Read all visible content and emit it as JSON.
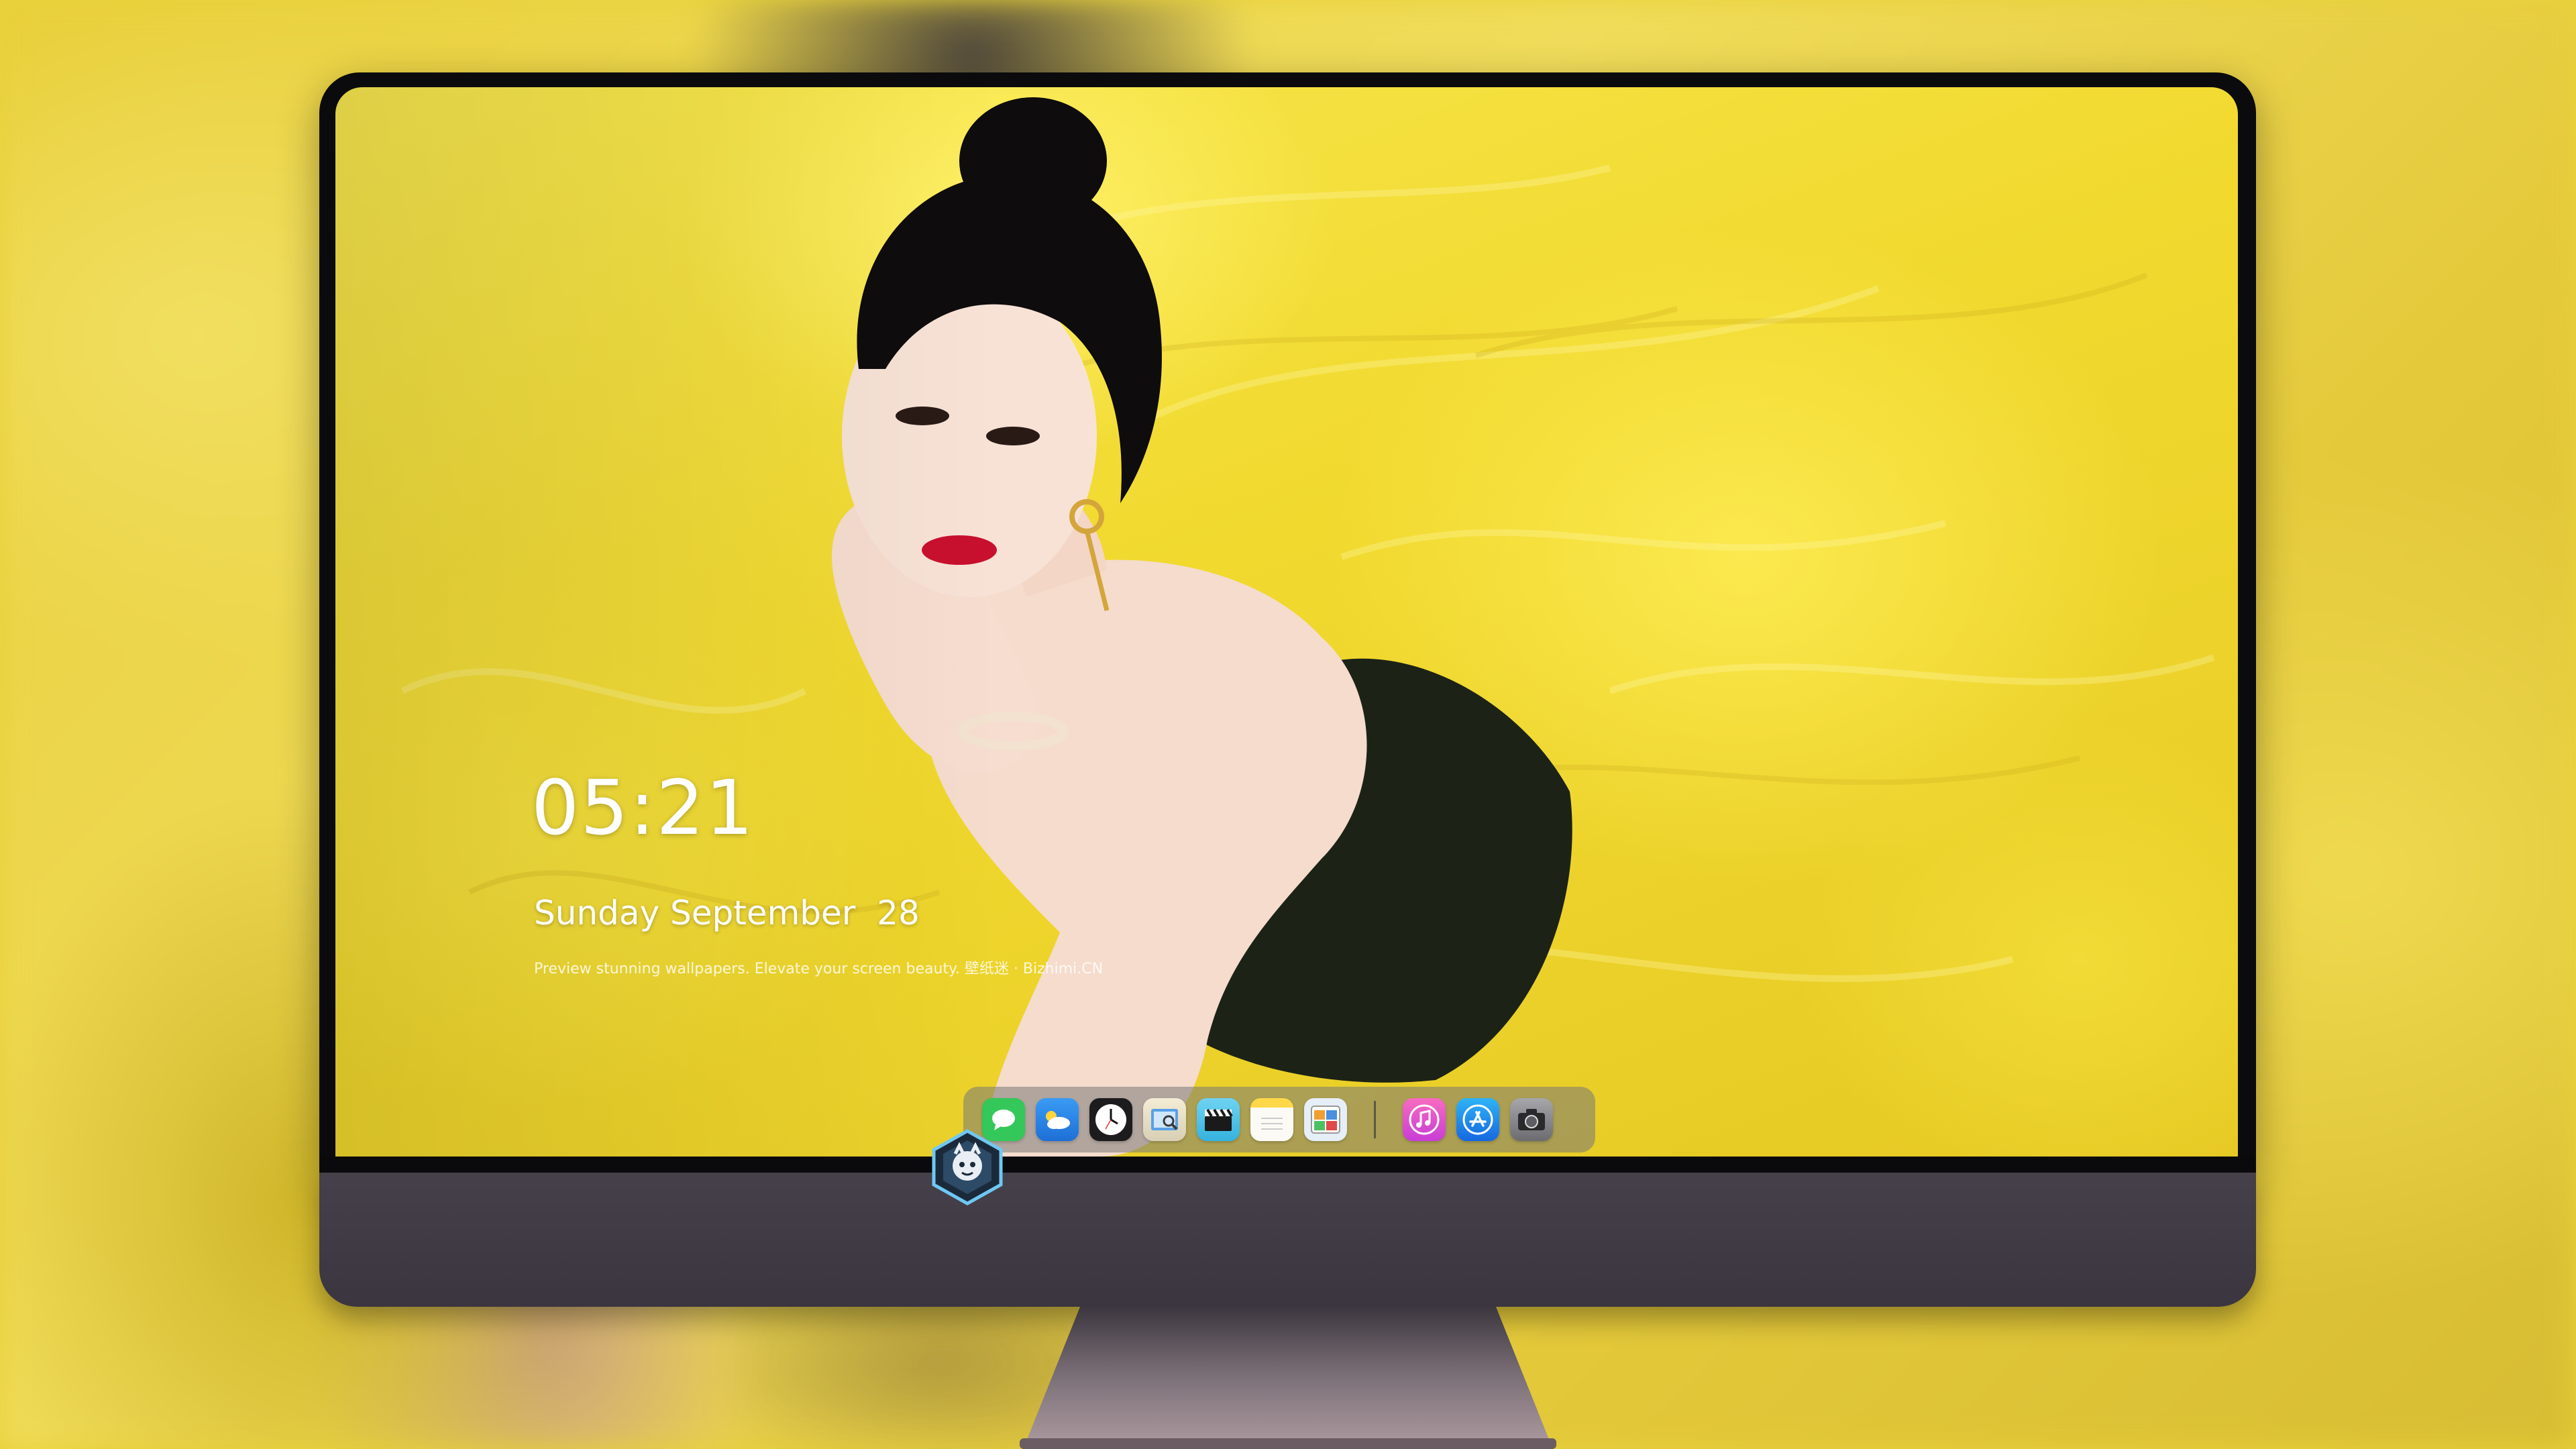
{
  "lockscreen": {
    "time": "05:21",
    "date": "Sunday September  28",
    "tagline": "Preview stunning wallpapers. Elevate your screen beauty. 壁纸迷 · Bizhimi.CN"
  },
  "dock": {
    "apps": [
      {
        "name": "messages-icon",
        "color": "#34c759",
        "glyph": "💬"
      },
      {
        "name": "weather-icon",
        "color": "#2f8cf0",
        "glyph": "⛅"
      },
      {
        "name": "clock-icon",
        "color": "#1c1c1e",
        "glyph": "🕐"
      },
      {
        "name": "preview-icon",
        "color": "#e9e2c9",
        "glyph": "🖼"
      },
      {
        "name": "video-clapper-icon",
        "color": "#4fc3e8",
        "glyph": "🎬"
      },
      {
        "name": "notes-icon",
        "color": "#fbfaf4",
        "glyph": "≡"
      },
      {
        "name": "photo-booth-icon",
        "color": "#e6eef7",
        "glyph": "▦"
      },
      {
        "name": "music-icon",
        "color": "#f0509a",
        "glyph": "♫"
      },
      {
        "name": "app-store-icon",
        "color": "#1e8cf0",
        "glyph": "A"
      },
      {
        "name": "camera-icon",
        "color": "#8e8e93",
        "glyph": "◉"
      }
    ]
  },
  "colors": {
    "wallpaper_accent": "#f1d92e",
    "chin": "#46404a",
    "bezel": "#0b0b0d"
  }
}
